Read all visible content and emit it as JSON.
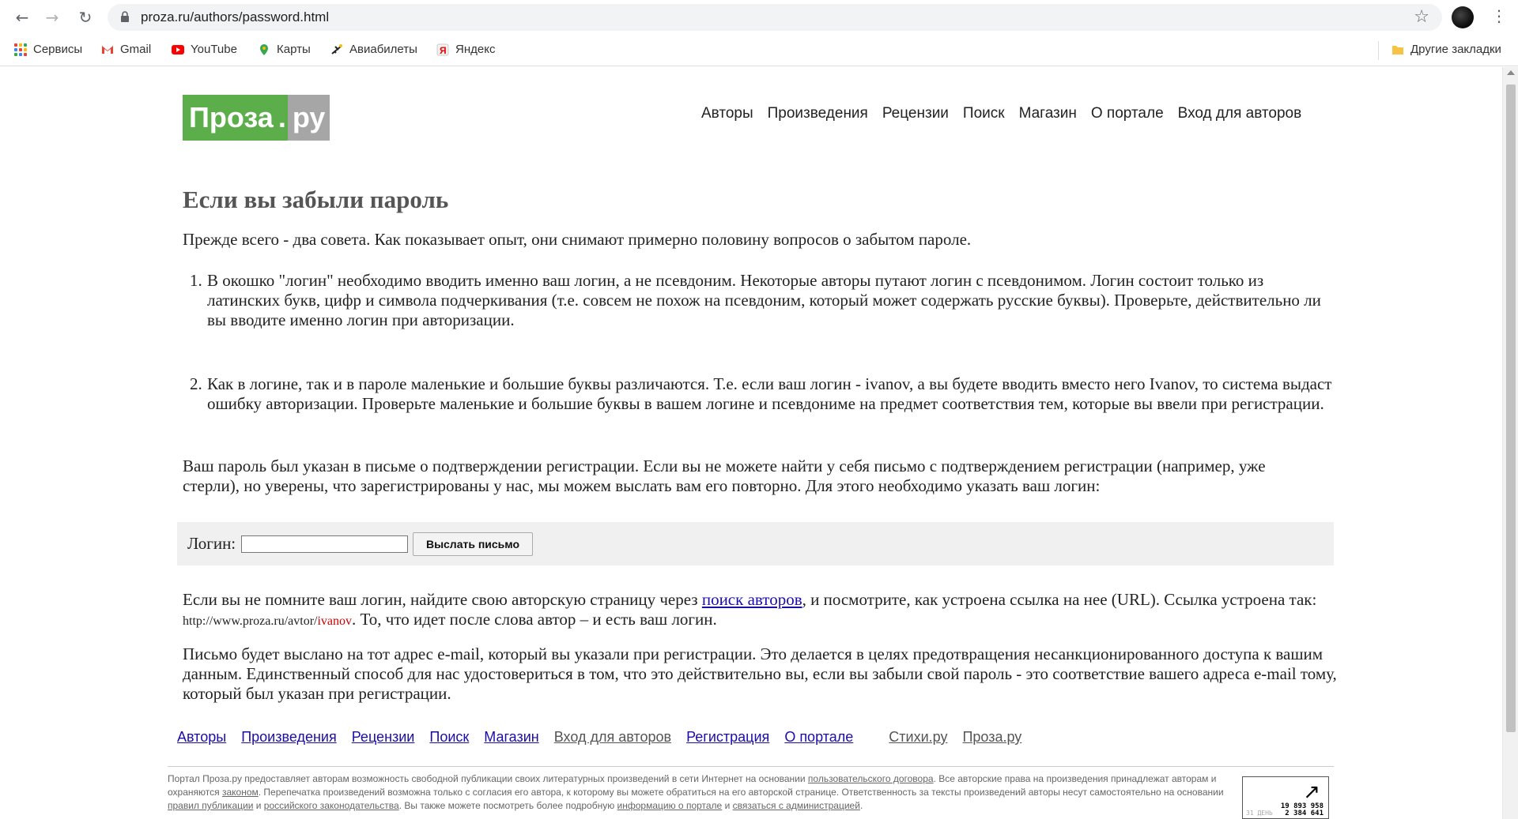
{
  "browser": {
    "url": "proza.ru/authors/password.html",
    "bookmarks": [
      {
        "label": "Сервисы",
        "icon": "apps-icon"
      },
      {
        "label": "Gmail",
        "icon": "gmail-icon"
      },
      {
        "label": "YouTube",
        "icon": "youtube-icon"
      },
      {
        "label": "Карты",
        "icon": "maps-icon"
      },
      {
        "label": "Авиабилеты",
        "icon": "airplane-icon"
      },
      {
        "label": "Яндекс",
        "icon": "yandex-icon"
      }
    ],
    "other_bookmarks": "Другие закладки"
  },
  "logo": {
    "main": "Проза",
    "dot": ".",
    "tld": "ру"
  },
  "topnav": [
    "Авторы",
    "Произведения",
    "Рецензии",
    "Поиск",
    "Магазин",
    "О портале",
    "Вход для авторов"
  ],
  "page": {
    "title": "Если вы забыли пароль",
    "intro": "Прежде всего - два совета. Как показывает опыт, они снимают примерно половину вопросов о забытом пароле.",
    "tips": [
      {
        "num": "1.",
        "text": "В окошко \"логин\" необходимо вводить именно ваш логин, а не псевдоним. Некоторые авторы путают логин с псевдонимом. Логин состоит только из латинских букв, цифр и символа подчеркивания (т.е. совсем не похож на псевдоним, который может содержать русские буквы). Проверьте, действительно ли вы вводите именно логин при авторизации."
      },
      {
        "num": "2.",
        "text": "Как в логине, так и в пароле маленькие и большие буквы различаются. Т.е. если ваш логин - ivanov, а вы будете вводить вместо него Ivanov, то система выдаст ошибку авторизации. Проверьте маленькие и большие буквы в вашем логине и псевдониме на предмет соответствия тем, которые вы ввели при регистрации."
      }
    ],
    "password_note": "Ваш пароль был указан в письме о подтверждении регистрации. Если вы не можете найти у себя письмо с подтверждением регистрации (например, уже стерли), но уверены, что зарегистрированы у нас, мы можем выслать вам его повторно. Для этого необходимо указать ваш логин:",
    "form": {
      "label": "Логин:",
      "value": "",
      "button": "Выслать письмо"
    },
    "login_hint_1": "Если вы не помните ваш логин, найдите свою авторскую страницу через ",
    "login_hint_link": "поиск авторов",
    "login_hint_2": ", и посмотрите, как устроена ссылка на нее (URL). Ссылка устроена так: ",
    "login_hint_url": "http://www.proza.ru/avtor/",
    "login_hint_url_login": "ivanov",
    "login_hint_3": ". То, что идет после слова автор – и есть ваш логин.",
    "email_note": "Письмо будет выслано на тот адрес e-mail, который вы указали при регистрации. Это делается в целях предотвращения несанкционированного доступа к вашим данным. Единственный способ для нас удостовериться в том, что это действительно вы, если вы забыли свой пароль - это соответствие вашего адреса e-mail тому, который был указан при регистрации."
  },
  "footnav": {
    "links": [
      "Авторы",
      "Произведения",
      "Рецензии",
      "Поиск",
      "Магазин",
      "Вход для авторов",
      "Регистрация",
      "О портале"
    ],
    "sites": [
      "Стихи.ру",
      "Проза.ру"
    ]
  },
  "footer": {
    "t1": "Портал Проза.ру предоставляет авторам возможность свободной публикации своих литературных произведений в сети Интернет на основании ",
    "l1": "пользовательского договора",
    "t2": ". Все авторские права на произведения принадлежат авторам и охраняются ",
    "l2": "законом",
    "t3": ". Перепечатка произведений возможна только с согласия его автора, к которому вы можете обратиться на его авторской странице. Ответственность за тексты произведений авторы несут самостоятельно на основании ",
    "l3": "правил публикации",
    "t4": " и ",
    "l4": "российского законодательства",
    "t5": ". Вы также можете посмотреть более подробную ",
    "l5": "информацию о портале",
    "t6": " и ",
    "l6": "связаться с администрацией",
    "t7": "."
  },
  "counter": {
    "n1": "19 893 958",
    "n2": "2 384 641",
    "d": "31 ДЕНЬ"
  },
  "colors": {
    "logo_green": "#5cae4b",
    "logo_gray": "#a6a6a6",
    "link": "#1a0dab"
  }
}
